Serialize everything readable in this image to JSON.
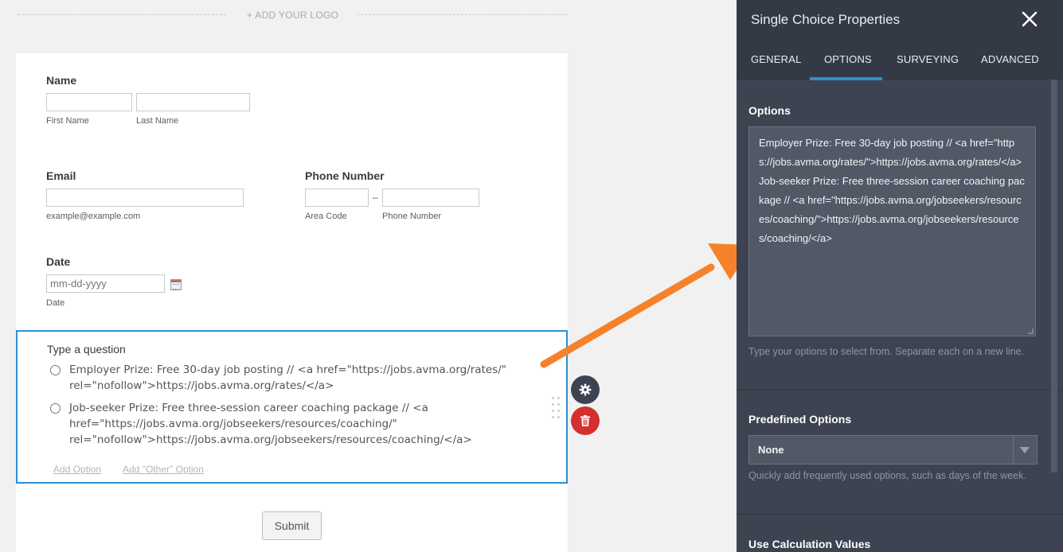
{
  "canvas": {
    "logo_text": "+ ADD YOUR LOGO"
  },
  "form": {
    "name": {
      "label": "Name",
      "first_sub": "First Name",
      "last_sub": "Last Name"
    },
    "email": {
      "label": "Email",
      "sub": "example@example.com"
    },
    "phone": {
      "label": "Phone Number",
      "area_sub": "Area Code",
      "number_sub": "Phone Number",
      "separator": "–"
    },
    "date": {
      "label": "Date",
      "placeholder": "mm-dd-yyyy",
      "sub": "Date"
    },
    "question": {
      "title": "Type a question",
      "options": [
        "Employer Prize: Free 30-day job posting // <a href=\"https://jobs.avma.org/rates/\" rel=\"nofollow\">https://jobs.avma.org/rates/</a>",
        "Job-seeker Prize: Free three-session career coaching package // <a href=\"https://jobs.avma.org/jobseekers/resources/coaching/\" rel=\"nofollow\">https://jobs.avma.org/jobseekers/resources/coaching/</a>"
      ],
      "add_option": "Add Option",
      "add_other_option": "Add \"Other\" Option"
    },
    "submit_label": "Submit"
  },
  "panel": {
    "title": "Single Choice Properties",
    "tabs": [
      "GENERAL",
      "OPTIONS",
      "SURVEYING",
      "ADVANCED"
    ],
    "active_tab": "OPTIONS",
    "options_section": {
      "title": "Options",
      "value": "Employer Prize: Free 30-day job posting // <a href=\"https://jobs.avma.org/rates/\">https://jobs.avma.org/rates/</a>\nJob-seeker Prize: Free three-session career coaching package // <a href=\"https://jobs.avma.org/jobseekers/resources/coaching/\">https://jobs.avma.org/jobseekers/resources/coaching/</a>",
      "help": "Type your options to select from. Separate each on a new line."
    },
    "predefined_section": {
      "title": "Predefined Options",
      "selected": "None",
      "help": "Quickly add frequently used options, such as days of the week."
    },
    "calc_section": {
      "title": "Use Calculation Values"
    }
  },
  "colors": {
    "accent": "#2b8fd6",
    "panel_bg": "#3d4350",
    "delete": "#d52f2f",
    "arrow": "#f5822a"
  }
}
